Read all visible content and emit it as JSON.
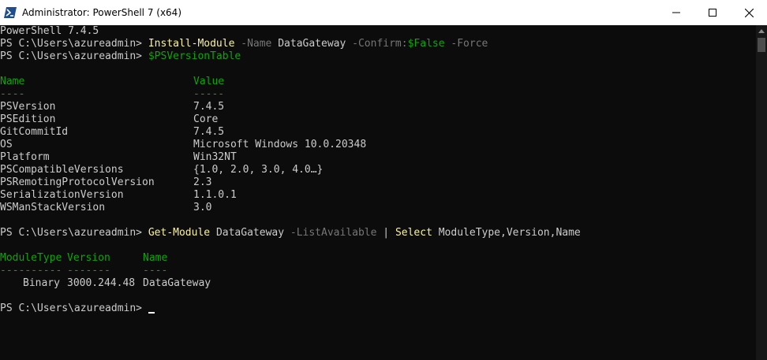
{
  "window": {
    "title": "Administrator: PowerShell 7 (x64)",
    "controls": {
      "minimize": "—",
      "maximize": "☐",
      "close": "✕"
    }
  },
  "console": {
    "version_line": "PowerShell 7.4.5",
    "prompt": "PS C:\\Users\\azureadmin>",
    "cmd1": {
      "command": "Install-Module",
      "p1": "-Name",
      "v1": "DataGateway",
      "p2": "-Confirm:",
      "v2": "$False",
      "p3": "-Force"
    },
    "cmd2": {
      "variable": "$PSVersionTable"
    },
    "table1": {
      "headers": [
        "Name",
        "Value"
      ],
      "dashes": [
        "----",
        "-----"
      ],
      "rows": [
        [
          "PSVersion",
          "7.4.5"
        ],
        [
          "PSEdition",
          "Core"
        ],
        [
          "GitCommitId",
          "7.4.5"
        ],
        [
          "OS",
          "Microsoft Windows 10.0.20348"
        ],
        [
          "Platform",
          "Win32NT"
        ],
        [
          "PSCompatibleVersions",
          "{1.0, 2.0, 3.0, 4.0…}"
        ],
        [
          "PSRemotingProtocolVersion",
          "2.3"
        ],
        [
          "SerializationVersion",
          "1.1.0.1"
        ],
        [
          "WSManStackVersion",
          "3.0"
        ]
      ]
    },
    "cmd3": {
      "command": "Get-Module",
      "arg": "DataGateway",
      "param": "-ListAvailable",
      "pipe": "|",
      "command2": "Select",
      "arg2": "ModuleType,Version,Name"
    },
    "table2": {
      "headers": [
        "ModuleType",
        "Version",
        "Name"
      ],
      "dashes": [
        "----------",
        "-------",
        "----"
      ],
      "rows": [
        [
          "Binary",
          "3000.244.48",
          "DataGateway"
        ]
      ]
    }
  },
  "colors": {
    "background": "#0c0c0c",
    "text": "#cccccc",
    "command": "#f9f1a5",
    "parameter": "#767676",
    "variable": "#13a10e",
    "header": "#13a10e"
  }
}
